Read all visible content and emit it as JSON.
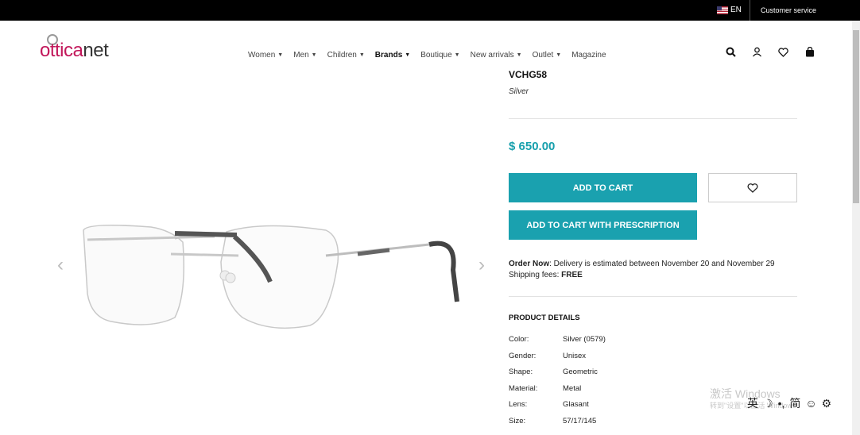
{
  "topbar": {
    "lang": "EN",
    "customer_service": "Customer service"
  },
  "logo": {
    "part1": "ottica",
    "part2": "net"
  },
  "nav": [
    {
      "label": "Women",
      "chevron": true
    },
    {
      "label": "Men",
      "chevron": true
    },
    {
      "label": "Children",
      "chevron": true
    },
    {
      "label": "Brands",
      "chevron": true,
      "bold": true
    },
    {
      "label": "Boutique",
      "chevron": true
    },
    {
      "label": "New arrivals",
      "chevron": true
    },
    {
      "label": "Outlet",
      "chevron": true
    },
    {
      "label": "Magazine",
      "chevron": false
    }
  ],
  "product": {
    "code": "VCHG58",
    "color": "Silver",
    "price": "$ 650.00",
    "add_to_cart": "ADD TO CART",
    "add_to_cart_rx": "ADD TO CART WITH PRESCRIPTION",
    "order_now": "Order Now",
    "delivery": ": Delivery is estimated between November 20 and November 29",
    "shipping_label": "Shipping fees: ",
    "shipping_value": "FREE"
  },
  "details": {
    "title": "PRODUCT DETAILS",
    "rows": [
      {
        "k": "Color:",
        "v": "Silver (0579)"
      },
      {
        "k": "Gender:",
        "v": "Unisex"
      },
      {
        "k": "Shape:",
        "v": "Geometric"
      },
      {
        "k": "Material:",
        "v": "Metal"
      },
      {
        "k": "Lens:",
        "v": "Glasant"
      },
      {
        "k": "Size:",
        "v": "57/17/145"
      }
    ]
  },
  "overlay": {
    "watermark": "激活 Windows",
    "watermark_sub": "转到\"设置\"以激活 Windows",
    "ime": [
      "英",
      "☽",
      "•,",
      "简",
      "☺",
      "⚙"
    ]
  },
  "colors": {
    "accent": "#1aa1af",
    "brand": "#c2185b"
  }
}
